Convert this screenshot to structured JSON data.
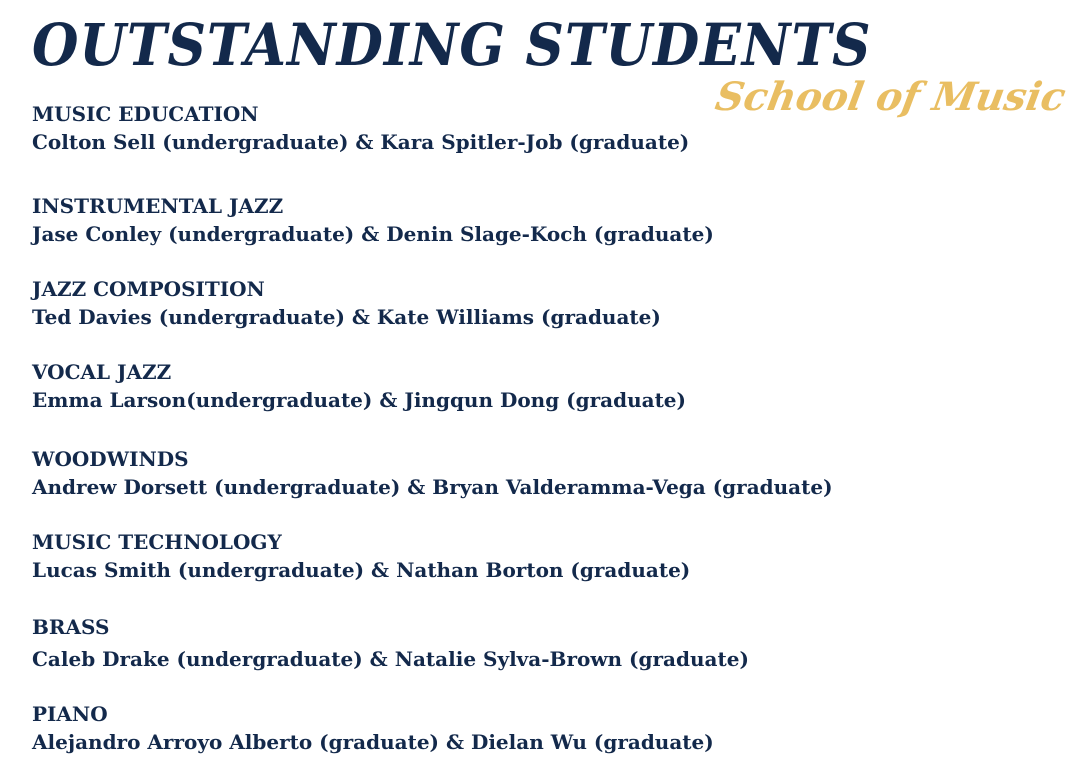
{
  "header": {
    "title": "OUTSTANDING STUDENTS",
    "subtitle": "School of Music"
  },
  "sections": [
    {
      "heading": "MUSIC EDUCATION",
      "names": "Colton Sell (undergraduate) & Kara Spitler-Job (graduate)"
    },
    {
      "heading": "INSTRUMENTAL JAZZ",
      "names": "Jase Conley (undergraduate) & Denin Slage-Koch (graduate)"
    },
    {
      "heading": "JAZZ COMPOSITION",
      "names": "Ted Davies (undergraduate) & Kate Williams (graduate)"
    },
    {
      "heading": "VOCAL JAZZ",
      "names": "Emma Larson(undergraduate) & Jingqun Dong (graduate)"
    },
    {
      "heading": "WOODWINDS",
      "names": "Andrew Dorsett (undergraduate) & Bryan Valderamma-Vega (graduate)"
    },
    {
      "heading": "MUSIC TECHNOLOGY",
      "names": "Lucas Smith (undergraduate) & Nathan Borton (graduate)"
    },
    {
      "heading": "BRASS",
      "names": "Caleb Drake (undergraduate) & Natalie Sylva-Brown (graduate)"
    },
    {
      "heading": "PIANO",
      "names": "Alejandro Arroyo Alberto (graduate) & Dielan Wu (graduate)"
    }
  ],
  "colors": {
    "text": "#13294b",
    "accent": "#e9be62",
    "background": "#ffffff"
  }
}
